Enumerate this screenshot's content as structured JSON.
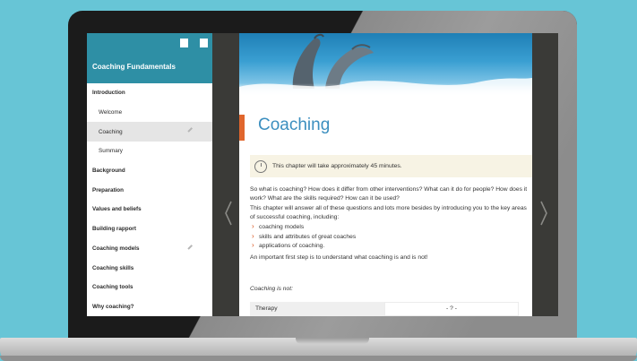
{
  "colors": {
    "background": "#67c5d6",
    "sidebar_header": "#2e8fa5",
    "accent_bar": "#e0662d",
    "chapter_title": "#3c8fbf",
    "notice_bg": "#f7f3e4"
  },
  "sidebar": {
    "title": "Coaching Fundamentals",
    "header_icons": [
      "bookmark-icon",
      "page-icon"
    ],
    "items": [
      {
        "label": "Introduction",
        "level": 1
      },
      {
        "label": "Welcome",
        "level": 2
      },
      {
        "label": "Coaching",
        "level": 2,
        "active": true,
        "editable": true
      },
      {
        "label": "Summary",
        "level": 2
      },
      {
        "label": "Background",
        "level": 1
      },
      {
        "label": "Preparation",
        "level": 1
      },
      {
        "label": "Values and beliefs",
        "level": 1
      },
      {
        "label": "Building rapport",
        "level": 1
      },
      {
        "label": "Coaching models",
        "level": 1,
        "editable": true
      },
      {
        "label": "Coaching skills",
        "level": 1
      },
      {
        "label": "Coaching tools",
        "level": 1
      },
      {
        "label": "Why coaching?",
        "level": 1
      }
    ]
  },
  "content": {
    "chapter_title": "Coaching",
    "notice": "This chapter will take approximately 45 minutes.",
    "para1": "So what is coaching? How does it differ from other interventions? What can it do for people? How does it work? What are the skills required? How can it be used?",
    "para2": "This chapter will answer all of these questions and lots more besides by introducing you to the key areas of successful coaching, including:",
    "bullets": [
      "coaching models",
      "skills and attributes of great coaches",
      "applications of coaching."
    ],
    "para3": "An important first step is to understand what coaching is and is not!",
    "not_label": "Coaching is not:",
    "table": {
      "row1_col1": "Therapy",
      "row1_col2": "- ? -"
    }
  },
  "navigation": {
    "prev_icon": "chevron-left-icon",
    "next_icon": "chevron-right-icon"
  }
}
